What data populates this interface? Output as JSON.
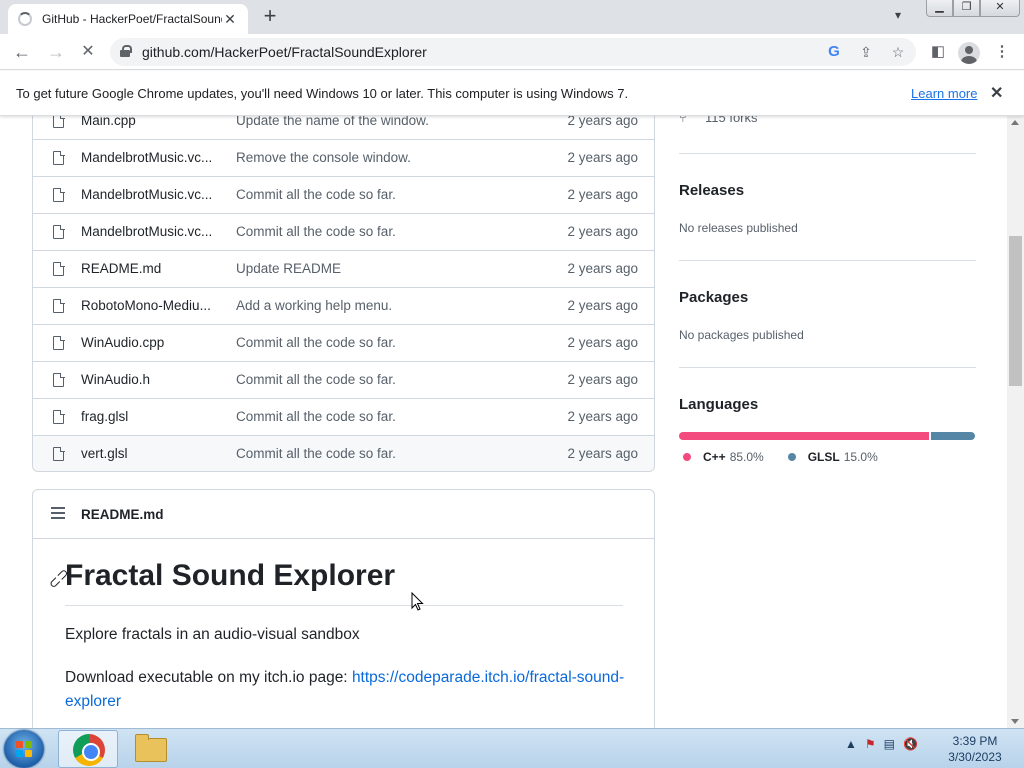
{
  "browser": {
    "tab_title": "GitHub - HackerPoet/FractalSoundExplorer",
    "url": "github.com/HackerPoet/FractalSoundExplorer"
  },
  "infobar": {
    "message": "To get future Google Chrome updates, you'll need Windows 10 or later. This computer is using Windows 7.",
    "learn_more": "Learn more"
  },
  "files": [
    {
      "name": "Main.cpp",
      "message": "Update the name of the window.",
      "age": "2 years ago"
    },
    {
      "name": "MandelbrotMusic.vc...",
      "message": "Remove the console window.",
      "age": "2 years ago"
    },
    {
      "name": "MandelbrotMusic.vc...",
      "message": "Commit all the code so far.",
      "age": "2 years ago"
    },
    {
      "name": "MandelbrotMusic.vc...",
      "message": "Commit all the code so far.",
      "age": "2 years ago"
    },
    {
      "name": "README.md",
      "message": "Update README",
      "age": "2 years ago"
    },
    {
      "name": "RobotoMono-Mediu...",
      "message": "Add a working help menu.",
      "age": "2 years ago"
    },
    {
      "name": "WinAudio.cpp",
      "message": "Commit all the code so far.",
      "age": "2 years ago"
    },
    {
      "name": "WinAudio.h",
      "message": "Commit all the code so far.",
      "age": "2 years ago"
    },
    {
      "name": "frag.glsl",
      "message": "Commit all the code so far.",
      "age": "2 years ago"
    },
    {
      "name": "vert.glsl",
      "message": "Commit all the code so far.",
      "age": "2 years ago"
    }
  ],
  "readme": {
    "header": "README.md",
    "title": "Fractal Sound Explorer",
    "tagline": "Explore fractals in an audio-visual sandbox",
    "download_prefix": "Download executable on my itch.io page: ",
    "download_link": "https://codeparade.itch.io/fractal-sound-explorer"
  },
  "sidebar": {
    "forks": "115 forks",
    "releases_title": "Releases",
    "releases_text": "No releases published",
    "packages_title": "Packages",
    "packages_text": "No packages published",
    "languages_title": "Languages",
    "languages": [
      {
        "name": "C++",
        "percent": "85.0%",
        "value": 85.0,
        "color": "#f34b7d"
      },
      {
        "name": "GLSL",
        "percent": "15.0%",
        "value": 15.0,
        "color": "#5686a5"
      }
    ]
  },
  "taskbar": {
    "time": "3:39 PM",
    "date": "3/30/2023"
  }
}
